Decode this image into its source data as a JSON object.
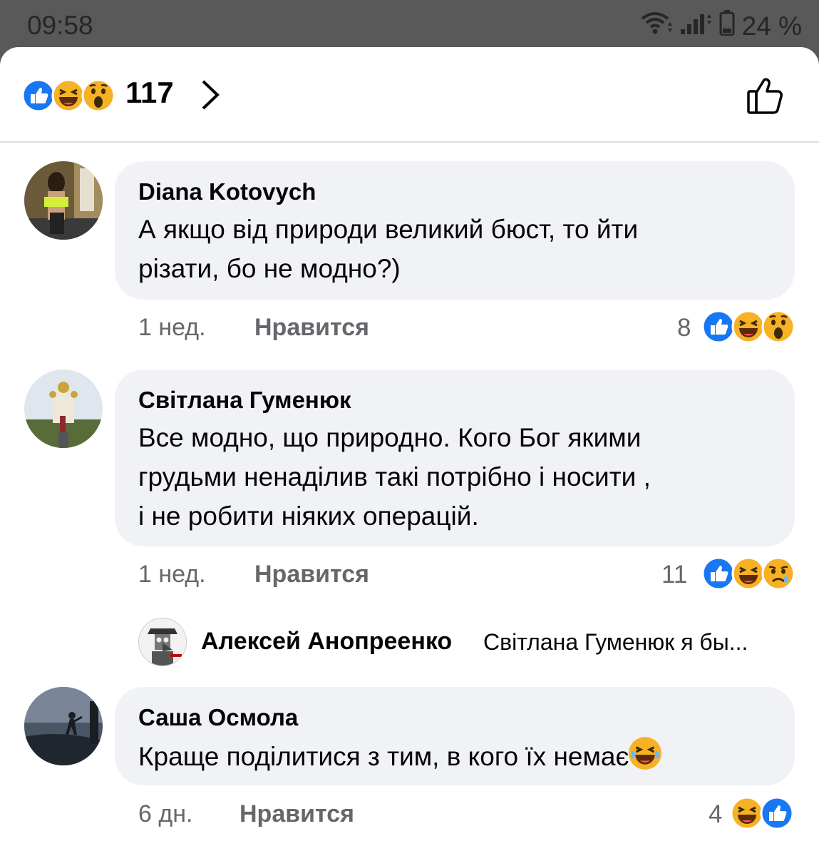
{
  "status_bar": {
    "time": "09:58",
    "battery": "24 %"
  },
  "header": {
    "reactions": [
      "like-icon",
      "haha-icon",
      "wow-icon"
    ],
    "total": "117"
  },
  "comments": [
    {
      "author": "Diana Kotovych",
      "lines": [
        "А якщо від природи великий бюст, то йти",
        "різати, бо не модно?)"
      ],
      "time": "1 нед.",
      "like_label": "Нравится",
      "reaction_count": "8",
      "reactions": [
        "like-icon",
        "haha-icon",
        "wow-icon"
      ]
    },
    {
      "author": "Світлана Гуменюк",
      "lines": [
        "Все модно, що природно. Кого Бог якими",
        "грудьми ненаділив такі потрібно і носити  ,",
        "і не робити ніяких операцій."
      ],
      "time": "1 нед.",
      "like_label": "Нравится",
      "reaction_count": "11",
      "reactions": [
        "like-icon",
        "haha-icon",
        "sad-icon"
      ],
      "reply": {
        "author": "Алексей Анопреенко",
        "preview": "Світлана Гуменюк я бы..."
      }
    },
    {
      "author": "Саша Осмола",
      "lines": [
        "Краще поділитися з тим, в кого їх немає"
      ],
      "time": "6 дн.",
      "like_label": "Нравится",
      "reaction_count": "4",
      "reactions": [
        "haha-icon",
        "like-icon"
      ]
    }
  ],
  "colors": {
    "like_blue": "#1877f2",
    "emoji_yellow": "#f7b125",
    "bubble_bg": "#f0f2f5",
    "meta_gray": "#65676b"
  }
}
